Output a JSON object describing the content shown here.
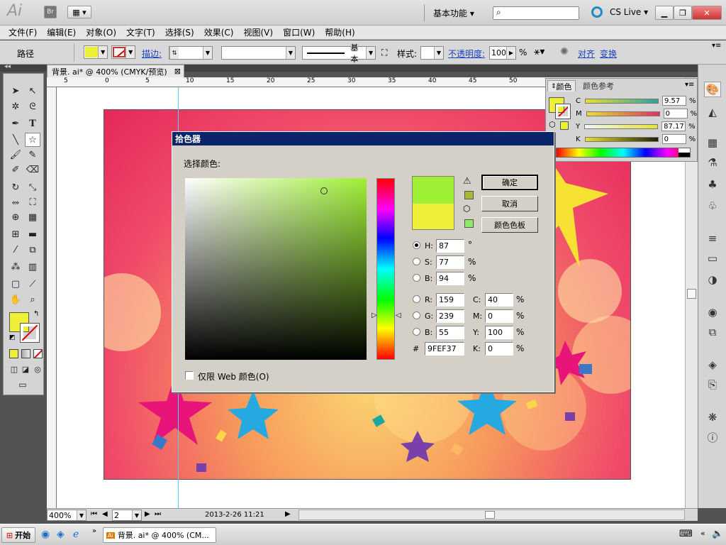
{
  "titlebar": {
    "logo": "Ai",
    "bridge": "Br",
    "workspace": "基本功能 ▾",
    "cs_live": "CS Live ▾"
  },
  "menu": [
    "文件(F)",
    "编辑(E)",
    "对象(O)",
    "文字(T)",
    "选择(S)",
    "效果(C)",
    "视图(V)",
    "窗口(W)",
    "帮助(H)"
  ],
  "control": {
    "object": "路径",
    "stroke_label": "描边:",
    "stroke_style": "基本",
    "style_label": "样式:",
    "opacity_label": "不透明度:",
    "opacity_value": "100",
    "opacity_unit": "%",
    "align": "对齐",
    "transform": "变换"
  },
  "doc": {
    "tab": "背景. ai* @ 400% (CMYK/预览)",
    "close": "⊠"
  },
  "ruler_h": [
    "5",
    "0",
    "5",
    "10",
    "15",
    "20",
    "25",
    "30",
    "35",
    "40",
    "45",
    "50"
  ],
  "color_panel": {
    "tab1": "颜色",
    "tab2": "颜色参考",
    "rows": [
      {
        "label": "C",
        "value": "9.57",
        "unit": "%"
      },
      {
        "label": "M",
        "value": "0",
        "unit": "%"
      },
      {
        "label": "Y",
        "value": "87.17",
        "unit": "%"
      },
      {
        "label": "K",
        "value": "0",
        "unit": "%"
      }
    ]
  },
  "dialog": {
    "title": "拾色器",
    "select_label": "选择颜色:",
    "ok": "确定",
    "cancel": "取消",
    "swatches": "颜色色板",
    "hsb": [
      {
        "label": "H:",
        "value": "87",
        "unit": "°"
      },
      {
        "label": "S:",
        "value": "77",
        "unit": "%"
      },
      {
        "label": "B:",
        "value": "94",
        "unit": "%"
      }
    ],
    "rgb": [
      {
        "label": "R:",
        "value": "159"
      },
      {
        "label": "G:",
        "value": "239"
      },
      {
        "label": "B:",
        "value": "55"
      }
    ],
    "cmyk": [
      {
        "label": "C:",
        "value": "40",
        "unit": "%"
      },
      {
        "label": "M:",
        "value": "0",
        "unit": "%"
      },
      {
        "label": "Y:",
        "value": "100",
        "unit": "%"
      },
      {
        "label": "K:",
        "value": "0",
        "unit": "%"
      }
    ],
    "hex_label": "#",
    "hex": "9FEF37",
    "web_only": "仅限 Web 颜色(O)",
    "new_color": "#9fef37",
    "old_color": "#eef037",
    "warn_color": "#a4b83a",
    "web_color": "#8ee86a"
  },
  "status": {
    "zoom": "400%",
    "page": "2",
    "date": "2013-2-26  11:21"
  },
  "taskbar": {
    "start": "开始",
    "app": "背景. ai* @ 400% (CM..."
  },
  "colors": {
    "fill": "#eef037",
    "accent": "#0a246a"
  }
}
